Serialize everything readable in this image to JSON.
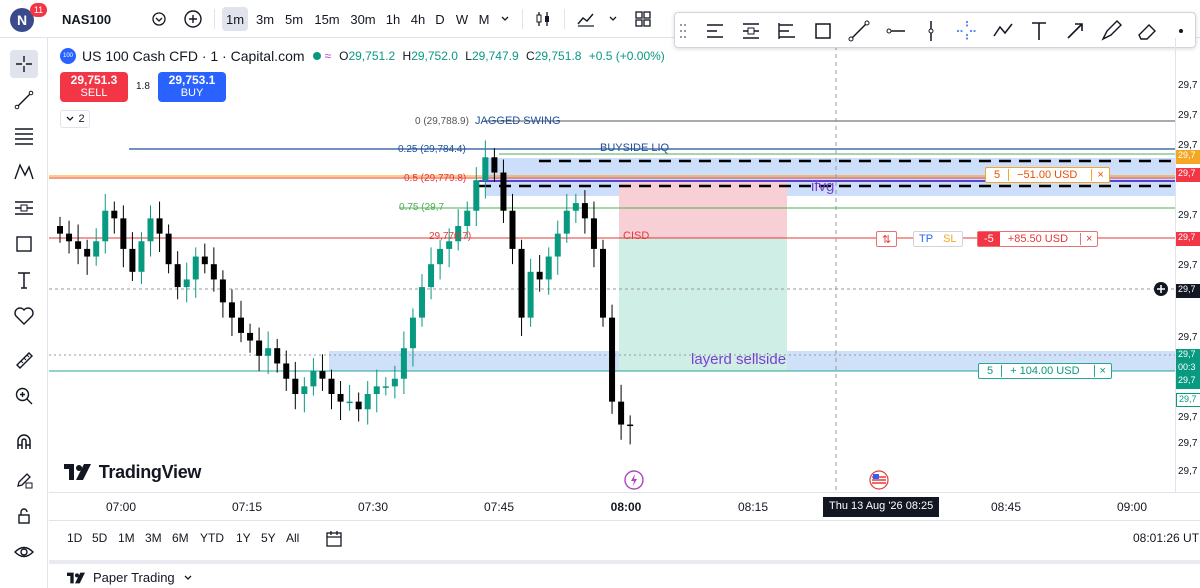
{
  "header": {
    "avatar_letter": "N",
    "notification_count": "11",
    "symbol": "NAS100",
    "timeframes": [
      "1m",
      "3m",
      "5m",
      "15m",
      "30m",
      "1h",
      "4h",
      "D",
      "W",
      "M"
    ],
    "active_timeframe": "1m"
  },
  "drawing_toolbar": {
    "tools": [
      "long-short-position-icon",
      "parallel-channel-icon",
      "pitchfork-icon",
      "rectangle-icon",
      "trendline-icon",
      "horizontal-ray-icon",
      "vertical-line-icon",
      "crosshair-icon",
      "path-icon",
      "text-icon",
      "arrow-icon",
      "brush-icon",
      "eraser-icon"
    ]
  },
  "legend": {
    "icon_text": "100",
    "title": "US 100 Cash CFD · 1 · Capital.com",
    "o_key": "O",
    "o": "29,751.2",
    "h_key": "H",
    "h": "29,752.0",
    "l_key": "L",
    "l": "29,747.9",
    "c_key": "C",
    "c": "29,751.8",
    "change": "+0.5 (+0.00%)",
    "sell_price": "29,751.3",
    "sell_label": "SELL",
    "spread": "1.8",
    "buy_price": "29,753.1",
    "buy_label": "BUY",
    "collapse_count": "2"
  },
  "drawings": {
    "fib_0": "0 (29,788.9)",
    "fib_025": "0.25 (29,784.4)",
    "fib_05": "0.5 (29,779.8)",
    "fib_075": "0.75 (29,7",
    "fib_1": "29,770.7)",
    "jagged_swing": "JAGGED SWING",
    "buyside_liq": "BUYSIDE LIQ",
    "fvg_label": "ifvg",
    "cisd_label": "CISD",
    "layered_label": "layerd sellside"
  },
  "positions": {
    "stop": {
      "qty": "5",
      "pnl": "−51.00 USD",
      "close": "×"
    },
    "main": {
      "reverse": "⇅",
      "tp": "TP",
      "sl": "SL",
      "qty": "-5",
      "pnl": "+85.50 USD",
      "close": "×"
    },
    "target": {
      "qty": "5",
      "pnl": "+ 104.00 USD",
      "close": "×"
    }
  },
  "brand": "TradingView",
  "time_axis": {
    "labels": [
      "07:00",
      "07:15",
      "07:30",
      "07:45",
      "08:00",
      "08:15",
      "08:45",
      "09:00"
    ],
    "crosshair": "Thu 13 Aug '26   08:25"
  },
  "price_axis": {
    "labels": [
      "29,7",
      "29,7",
      "29,7",
      "29,7",
      "29,7",
      "29,7",
      "29,7",
      "29,7",
      "29,7",
      "29,7",
      "29,7"
    ],
    "tags": [
      "29,7",
      "29,7",
      "29,7",
      "29,7",
      "29,7",
      "00:3",
      "29,7",
      "29,7"
    ]
  },
  "range_bar": {
    "ranges": [
      "1D",
      "5D",
      "1M",
      "3M",
      "6M",
      "YTD",
      "1Y",
      "5Y",
      "All"
    ],
    "clock": "08:01:26 UT"
  },
  "panel": {
    "title": "Paper Trading"
  },
  "colors": {
    "up": "#089981",
    "down": "#000000",
    "sell": "#f23645",
    "buy": "#2962ff",
    "fvg_zone": "#bbd3f7",
    "profit_zone": "#cfeee6",
    "loss_zone": "#f8cfd5"
  },
  "chart_data": {
    "type": "candlestick",
    "instrument": "US 100 Cash CFD",
    "interval": "1m",
    "x_range": [
      "06:55",
      "09:02"
    ],
    "y_range_approx": [
      29745,
      29800
    ],
    "candles_close_approx": [
      29777,
      29776,
      29775,
      29774,
      29776,
      29780,
      29779,
      29775,
      29772,
      29776,
      29779,
      29777,
      29773,
      29770,
      29771,
      29774,
      29773,
      29771,
      29768,
      29766,
      29764,
      29763,
      29761,
      29762,
      29760,
      29758,
      29756,
      29757,
      29759,
      29758,
      29756,
      29755,
      29755,
      29754,
      29756,
      29757,
      29757,
      29758,
      29762,
      29766,
      29770,
      29773,
      29775,
      29776,
      29778,
      29780,
      29784,
      29787,
      29785,
      29780,
      29775,
      29766,
      29772,
      29771,
      29774,
      29777,
      29780,
      29781,
      29779,
      29775,
      29766,
      29755,
      29752,
      29751.8
    ]
  }
}
